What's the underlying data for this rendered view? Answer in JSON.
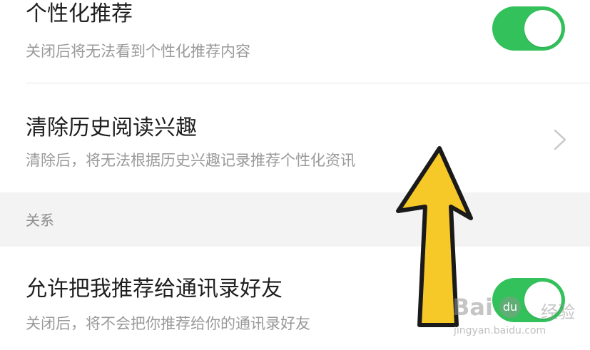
{
  "settings": {
    "personalized": {
      "title": "个性化推荐",
      "subtitle": "关闭后将无法看到个性化推荐内容",
      "enabled": true
    },
    "clear_history": {
      "title": "清除历史阅读兴趣",
      "subtitle": "清除后，将无法根据历史兴趣记录推荐个性化资讯"
    },
    "section_relations": {
      "label": "关系"
    },
    "recommend_to_contacts": {
      "title": "允许把我推荐给通讯录好友",
      "subtitle": "关闭后，将不会把你推荐给你的通讯录好友",
      "enabled": true
    }
  },
  "colors": {
    "toggle_on": "#33c15b",
    "arrow_fill": "#f7c928",
    "arrow_outline": "#1a1a1a",
    "section_bg": "#f3f3f3"
  },
  "icons": {
    "chevron": "chevron-right-icon",
    "annotation": "up-arrow-annotation-icon"
  },
  "watermark": {
    "brand": "Bai",
    "brand_suffix": "经验",
    "url": "jingyan.baidu.com"
  }
}
